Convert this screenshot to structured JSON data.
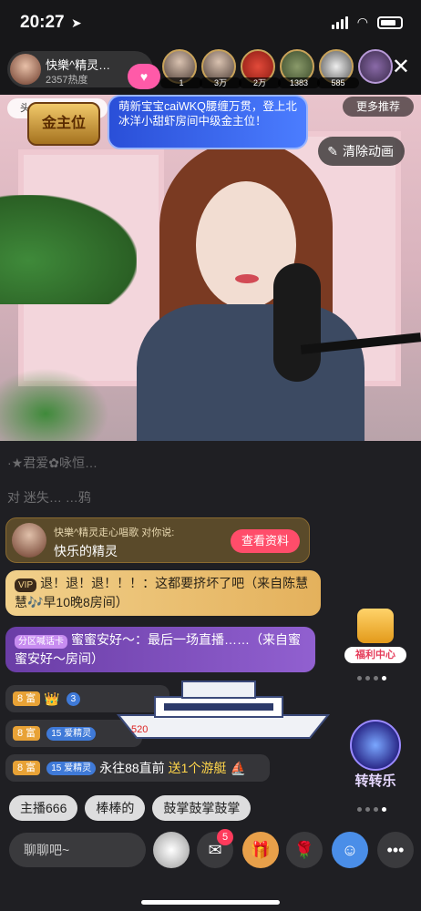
{
  "status_bar": {
    "time": "20:27",
    "location_icon": "arrow-icon"
  },
  "header": {
    "host_name": "快樂^精灵…",
    "host_hot": "2357热度",
    "viewers": [
      {
        "label": "1"
      },
      {
        "label": "3万"
      },
      {
        "label": "2万"
      },
      {
        "label": "1383"
      },
      {
        "label": "585"
      }
    ]
  },
  "video": {
    "news_pill": "头条",
    "banner_text": "萌新宝宝caiWKQ腰缠万贯，登上北冰洋小甜虾房间中级金主位！",
    "badge_text": "金主位",
    "more_recommend": "更多推荐",
    "clear_fx": "清除动画"
  },
  "chat": {
    "dim_row1": "·★君爱✿咏恒…",
    "dim_row2": "对 迷失… …鸦",
    "card": {
      "line1": "快樂^精灵走心唱歌 对你说:",
      "line2": "快乐的精灵",
      "button": "查看资料"
    },
    "msg1": {
      "vip": "VIP",
      "text": "退！退！退！！！：这都要挤坏了吧（来自陈慧慧🎶早10晚8房间）"
    },
    "msg2": {
      "tag": "分区喊话卡",
      "text": "蜜蜜安好～：最后一场直播……（来自蜜蜜安好～房间）"
    },
    "rows": [
      {
        "rank": "8 富",
        "level": "3"
      },
      {
        "rank": "8 富",
        "level": "15 爱精灵"
      },
      {
        "rank": "8 富",
        "level": "15 爱精灵",
        "name": "永往88直前",
        "action": "送1个游艇"
      }
    ],
    "yacht_number": "520",
    "welfare": "福利中心",
    "spin": "转转乐"
  },
  "quick_replies": [
    "主播666",
    "棒棒的",
    "鼓掌鼓掌鼓掌"
  ],
  "bottom": {
    "input_placeholder": "聊聊吧~",
    "message_badge": "5"
  }
}
